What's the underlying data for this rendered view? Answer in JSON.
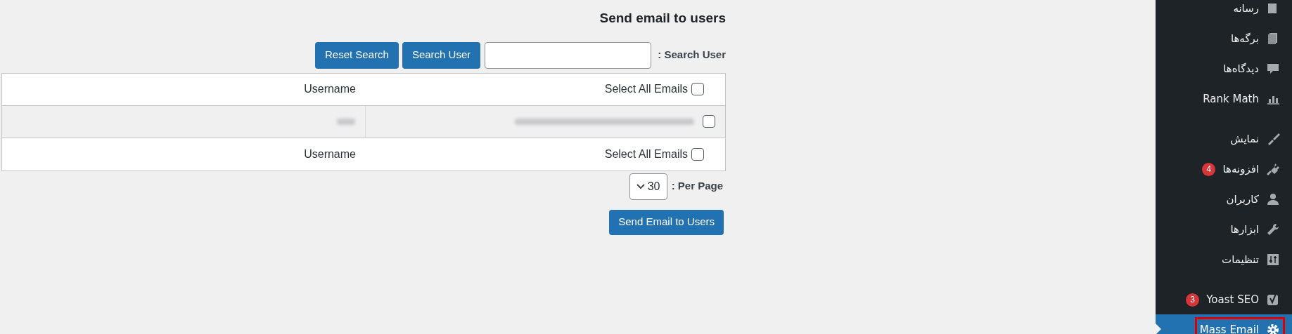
{
  "page": {
    "title": "Send email to users"
  },
  "search": {
    "label": ": Search User",
    "buttons": [
      {
        "kind": "search",
        "label": "Search User"
      },
      {
        "kind": "reset",
        "label": "Reset Search"
      }
    ]
  },
  "table": {
    "header": {
      "select_all": "Select All Emails",
      "checked": false,
      "username": "Username"
    },
    "rows": [
      {
        "checked": false
      }
    ],
    "footer": {
      "select_all": "Select All Emails",
      "checked": false,
      "username": "Username"
    }
  },
  "per_page": {
    "label": ": Per Page",
    "value": "30"
  },
  "send_button": "Send Email to Users",
  "sidebar": {
    "groups": [
      {
        "items": [
          {
            "label": "رسانه",
            "kind": "media",
            "selected": false
          },
          {
            "label": "برگه‌ها",
            "kind": "pages",
            "selected": false
          },
          {
            "label": "دیدگاه‌ها",
            "kind": "comments",
            "selected": false
          },
          {
            "label": "Rank Math",
            "kind": "chart",
            "selected": false
          }
        ]
      },
      {
        "items": [
          {
            "label": "نمایش",
            "kind": "brush",
            "selected": false
          },
          {
            "label": "افزونه‌ها",
            "kind": "plug",
            "selected": false,
            "badge": "4"
          },
          {
            "label": "کاربران",
            "kind": "user",
            "selected": false
          },
          {
            "label": "ابزارها",
            "kind": "wrench",
            "selected": false
          },
          {
            "label": "تنظیمات",
            "kind": "sliders",
            "selected": false
          }
        ]
      },
      {
        "items": [
          {
            "label": "Yoast SEO",
            "kind": "yoast",
            "selected": false,
            "badge": "3"
          },
          {
            "label": "Mass Email",
            "kind": "gear",
            "selected": true,
            "outlined": true
          }
        ]
      }
    ]
  }
}
